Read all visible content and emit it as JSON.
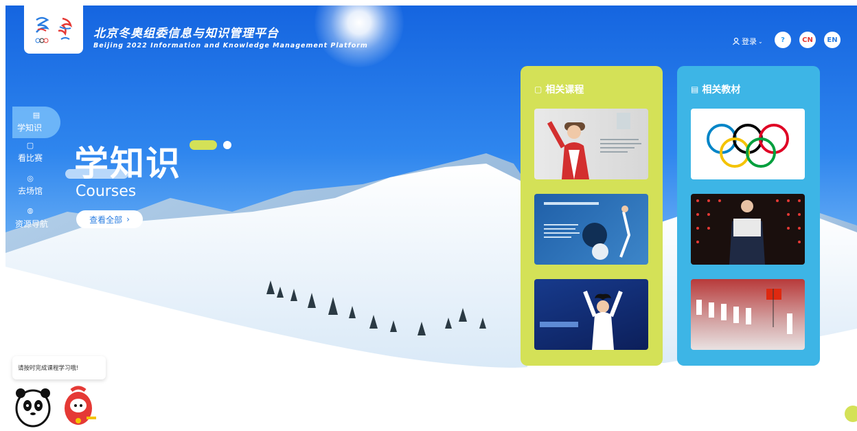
{
  "header": {
    "title_cn": "北京冬奥组委信息与知识管理平台",
    "title_en": "Beijing 2022 Information and Knowledge Management Platform",
    "login_label": "登录",
    "help_label": "?",
    "lang_cn": "CN",
    "lang_en": "EN"
  },
  "sidebar": {
    "items": [
      {
        "label": "学知识",
        "icon": "book-icon",
        "active": true
      },
      {
        "label": "看比赛",
        "icon": "video-icon",
        "active": false
      },
      {
        "label": "去场馆",
        "icon": "location-pin-icon",
        "active": false
      },
      {
        "label": "资源导航",
        "icon": "compass-icon",
        "active": false
      }
    ]
  },
  "hero": {
    "title_cn": "学知识",
    "title_en": "Courses",
    "view_all_label": "查看全部"
  },
  "panels": {
    "courses": {
      "title": "相关课程",
      "color": "#d4e157"
    },
    "materials": {
      "title": "相关教材",
      "color": "#3db5e6"
    }
  },
  "notice": {
    "text": "请按时完成课程学习哦!"
  },
  "colors": {
    "accent_lime": "#d4e157",
    "accent_blue": "#3db5e6",
    "lang_cn": "#e53935",
    "lang_en": "#2a7de1"
  }
}
